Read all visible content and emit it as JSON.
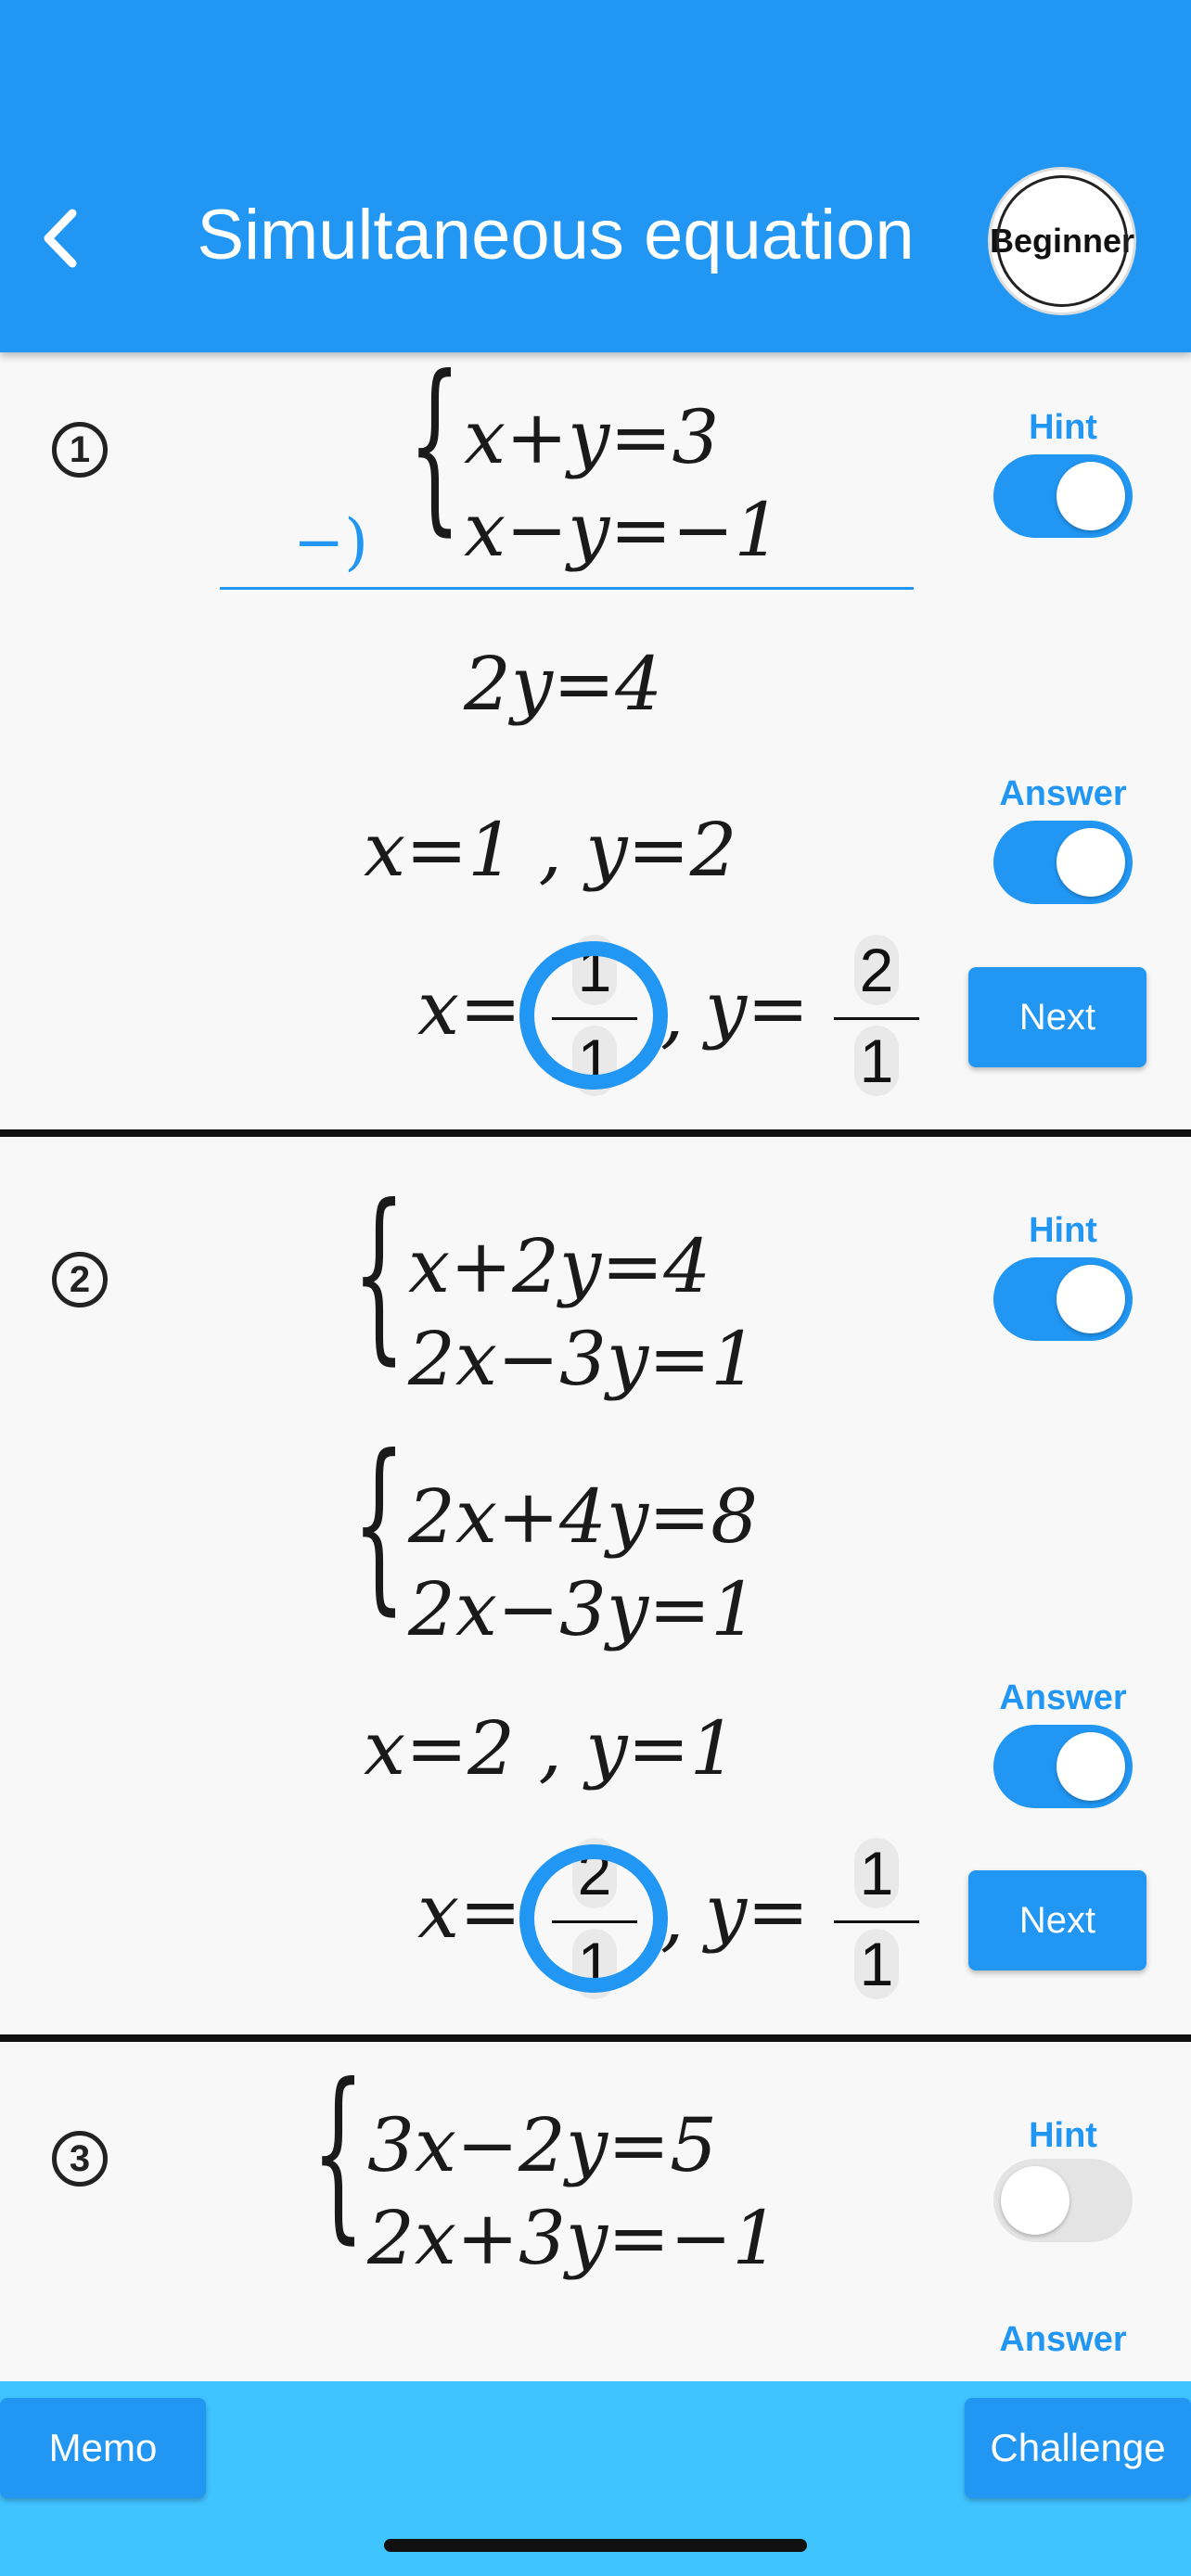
{
  "header": {
    "title": "Simultaneous equation",
    "level_badge": "Beginner"
  },
  "colors": {
    "primary": "#2196f3",
    "bottom_bar": "#40c4ff"
  },
  "problems": [
    {
      "number": "1",
      "eq1": "x+y=3",
      "eq2": "x−y=−1",
      "hint_label": "Hint",
      "hint_on": true,
      "hint_op": "−)",
      "hint_result": "2y=4",
      "answer_label": "Answer",
      "answer_on": true,
      "answer_text": "x=1 , y=2",
      "input_x_label": "x=",
      "input_x_num": "1",
      "input_x_den": "1",
      "input_comma": ",",
      "input_y_label": "y=",
      "input_y_num": "2",
      "input_y_den": "1",
      "next_label": "Next"
    },
    {
      "number": "2",
      "eq1": "x+2y=4",
      "eq2": "2x−3y=1",
      "hint_label": "Hint",
      "hint_on": true,
      "hint_eq1": "2x+4y=8",
      "hint_eq2": "2x−3y=1",
      "answer_label": "Answer",
      "answer_on": true,
      "answer_text": "x=2 , y=1",
      "input_x_label": "x=",
      "input_x_num": "2",
      "input_x_den": "1",
      "input_comma": ",",
      "input_y_label": "y=",
      "input_y_num": "1",
      "input_y_den": "1",
      "next_label": "Next"
    },
    {
      "number": "3",
      "eq1": "3x−2y=5",
      "eq2": "2x+3y=−1",
      "hint_label": "Hint",
      "hint_on": false,
      "answer_label": "Answer",
      "answer_on": false
    }
  ],
  "bottom": {
    "memo_label": "Memo",
    "challenge_label": "Challenge"
  },
  "icons": {
    "back": "chevron-left-icon",
    "number": "circled-number-icon",
    "correct_mark": "correct-circle-icon"
  }
}
